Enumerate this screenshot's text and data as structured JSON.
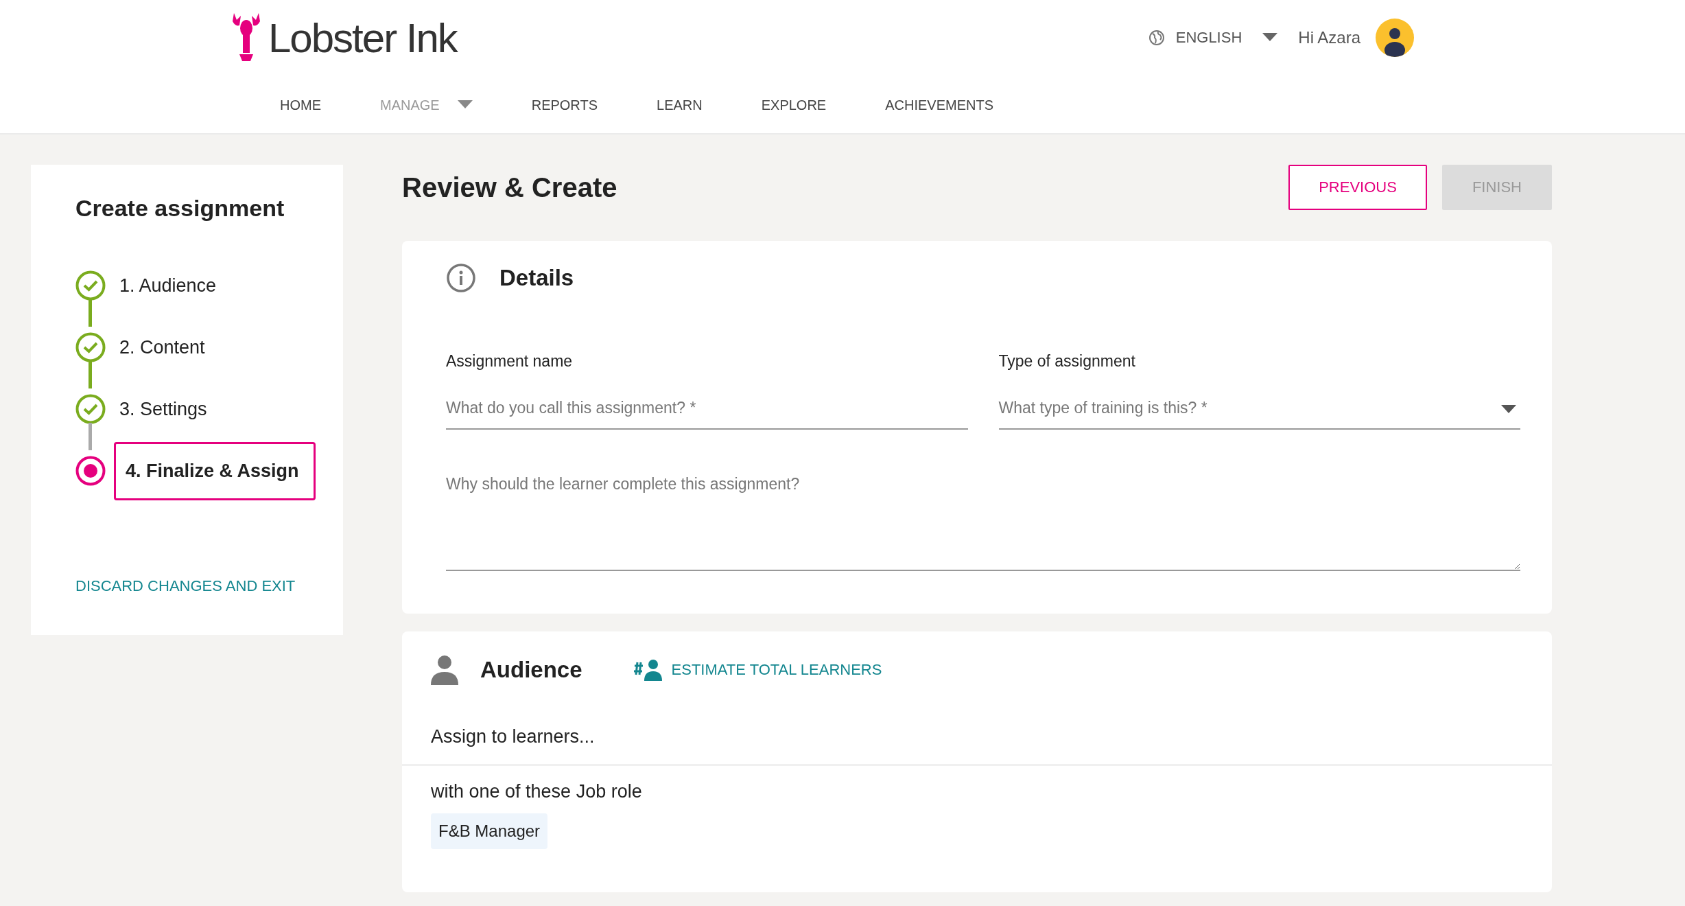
{
  "header": {
    "logo": "Lobster Ink",
    "language": "ENGLISH",
    "greeting": "Hi Azara"
  },
  "nav": [
    {
      "label": "HOME",
      "dimmed": false,
      "dropdown": false
    },
    {
      "label": "MANAGE",
      "dimmed": true,
      "dropdown": true
    },
    {
      "label": "REPORTS",
      "dimmed": false,
      "dropdown": false
    },
    {
      "label": "LEARN",
      "dimmed": false,
      "dropdown": false
    },
    {
      "label": "EXPLORE",
      "dimmed": false,
      "dropdown": false
    },
    {
      "label": "ACHIEVEMENTS",
      "dimmed": false,
      "dropdown": false
    }
  ],
  "sidebar": {
    "title": "Create assignment",
    "steps": [
      {
        "label": "1. Audience",
        "completed": true,
        "selected": false
      },
      {
        "label": "2. Content",
        "completed": true,
        "selected": false
      },
      {
        "label": "3. Settings",
        "completed": true,
        "selected": false
      },
      {
        "label": "4. Finalize & Assign",
        "completed": false,
        "selected": true
      }
    ],
    "discard": "DISCARD CHANGES AND EXIT"
  },
  "page": {
    "title": "Review & Create",
    "buttons": [
      {
        "label": "PREVIOUS",
        "disabled": false
      },
      {
        "label": "FINISH",
        "disabled": true
      }
    ]
  },
  "details": {
    "title": "Details",
    "fields": [
      {
        "label": "Assignment name",
        "placeholder": "What do you call this assignment? *",
        "kind": "text"
      },
      {
        "label": "Type of assignment",
        "placeholder": "What type of training is this? *",
        "kind": "select"
      }
    ],
    "reason": {
      "placeholder": "Why should the learner complete this assignment?"
    }
  },
  "audience": {
    "title": "Audience",
    "estimate": "ESTIMATE TOTAL LEARNERS",
    "intro": "Assign to learners...",
    "criteria": "with one of these Job role",
    "tags": [
      "F&B Manager"
    ]
  }
}
